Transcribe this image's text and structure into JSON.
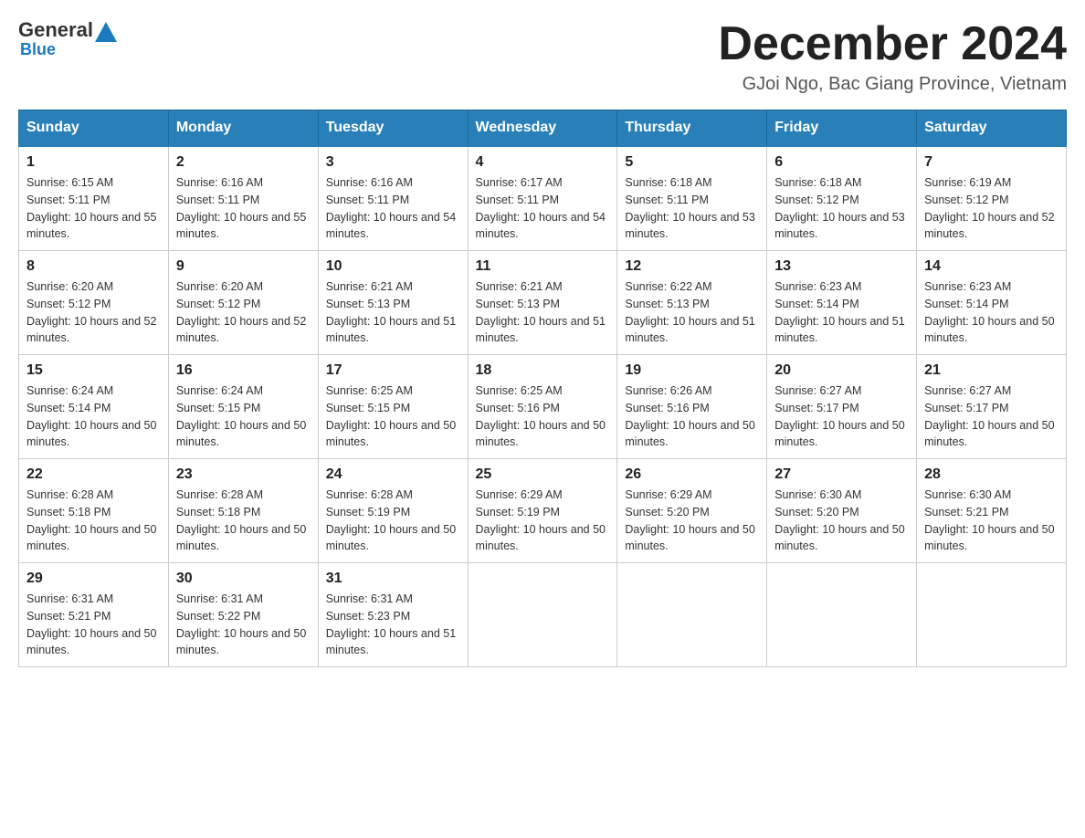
{
  "logo": {
    "general": "General",
    "blue": "Blue"
  },
  "header": {
    "month": "December 2024",
    "location": "GJoi Ngo, Bac Giang Province, Vietnam"
  },
  "weekdays": [
    "Sunday",
    "Monday",
    "Tuesday",
    "Wednesday",
    "Thursday",
    "Friday",
    "Saturday"
  ],
  "weeks": [
    [
      {
        "day": "1",
        "sunrise": "6:15 AM",
        "sunset": "5:11 PM",
        "daylight": "10 hours and 55 minutes."
      },
      {
        "day": "2",
        "sunrise": "6:16 AM",
        "sunset": "5:11 PM",
        "daylight": "10 hours and 55 minutes."
      },
      {
        "day": "3",
        "sunrise": "6:16 AM",
        "sunset": "5:11 PM",
        "daylight": "10 hours and 54 minutes."
      },
      {
        "day": "4",
        "sunrise": "6:17 AM",
        "sunset": "5:11 PM",
        "daylight": "10 hours and 54 minutes."
      },
      {
        "day": "5",
        "sunrise": "6:18 AM",
        "sunset": "5:11 PM",
        "daylight": "10 hours and 53 minutes."
      },
      {
        "day": "6",
        "sunrise": "6:18 AM",
        "sunset": "5:12 PM",
        "daylight": "10 hours and 53 minutes."
      },
      {
        "day": "7",
        "sunrise": "6:19 AM",
        "sunset": "5:12 PM",
        "daylight": "10 hours and 52 minutes."
      }
    ],
    [
      {
        "day": "8",
        "sunrise": "6:20 AM",
        "sunset": "5:12 PM",
        "daylight": "10 hours and 52 minutes."
      },
      {
        "day": "9",
        "sunrise": "6:20 AM",
        "sunset": "5:12 PM",
        "daylight": "10 hours and 52 minutes."
      },
      {
        "day": "10",
        "sunrise": "6:21 AM",
        "sunset": "5:13 PM",
        "daylight": "10 hours and 51 minutes."
      },
      {
        "day": "11",
        "sunrise": "6:21 AM",
        "sunset": "5:13 PM",
        "daylight": "10 hours and 51 minutes."
      },
      {
        "day": "12",
        "sunrise": "6:22 AM",
        "sunset": "5:13 PM",
        "daylight": "10 hours and 51 minutes."
      },
      {
        "day": "13",
        "sunrise": "6:23 AM",
        "sunset": "5:14 PM",
        "daylight": "10 hours and 51 minutes."
      },
      {
        "day": "14",
        "sunrise": "6:23 AM",
        "sunset": "5:14 PM",
        "daylight": "10 hours and 50 minutes."
      }
    ],
    [
      {
        "day": "15",
        "sunrise": "6:24 AM",
        "sunset": "5:14 PM",
        "daylight": "10 hours and 50 minutes."
      },
      {
        "day": "16",
        "sunrise": "6:24 AM",
        "sunset": "5:15 PM",
        "daylight": "10 hours and 50 minutes."
      },
      {
        "day": "17",
        "sunrise": "6:25 AM",
        "sunset": "5:15 PM",
        "daylight": "10 hours and 50 minutes."
      },
      {
        "day": "18",
        "sunrise": "6:25 AM",
        "sunset": "5:16 PM",
        "daylight": "10 hours and 50 minutes."
      },
      {
        "day": "19",
        "sunrise": "6:26 AM",
        "sunset": "5:16 PM",
        "daylight": "10 hours and 50 minutes."
      },
      {
        "day": "20",
        "sunrise": "6:27 AM",
        "sunset": "5:17 PM",
        "daylight": "10 hours and 50 minutes."
      },
      {
        "day": "21",
        "sunrise": "6:27 AM",
        "sunset": "5:17 PM",
        "daylight": "10 hours and 50 minutes."
      }
    ],
    [
      {
        "day": "22",
        "sunrise": "6:28 AM",
        "sunset": "5:18 PM",
        "daylight": "10 hours and 50 minutes."
      },
      {
        "day": "23",
        "sunrise": "6:28 AM",
        "sunset": "5:18 PM",
        "daylight": "10 hours and 50 minutes."
      },
      {
        "day": "24",
        "sunrise": "6:28 AM",
        "sunset": "5:19 PM",
        "daylight": "10 hours and 50 minutes."
      },
      {
        "day": "25",
        "sunrise": "6:29 AM",
        "sunset": "5:19 PM",
        "daylight": "10 hours and 50 minutes."
      },
      {
        "day": "26",
        "sunrise": "6:29 AM",
        "sunset": "5:20 PM",
        "daylight": "10 hours and 50 minutes."
      },
      {
        "day": "27",
        "sunrise": "6:30 AM",
        "sunset": "5:20 PM",
        "daylight": "10 hours and 50 minutes."
      },
      {
        "day": "28",
        "sunrise": "6:30 AM",
        "sunset": "5:21 PM",
        "daylight": "10 hours and 50 minutes."
      }
    ],
    [
      {
        "day": "29",
        "sunrise": "6:31 AM",
        "sunset": "5:21 PM",
        "daylight": "10 hours and 50 minutes."
      },
      {
        "day": "30",
        "sunrise": "6:31 AM",
        "sunset": "5:22 PM",
        "daylight": "10 hours and 50 minutes."
      },
      {
        "day": "31",
        "sunrise": "6:31 AM",
        "sunset": "5:23 PM",
        "daylight": "10 hours and 51 minutes."
      },
      null,
      null,
      null,
      null
    ]
  ]
}
